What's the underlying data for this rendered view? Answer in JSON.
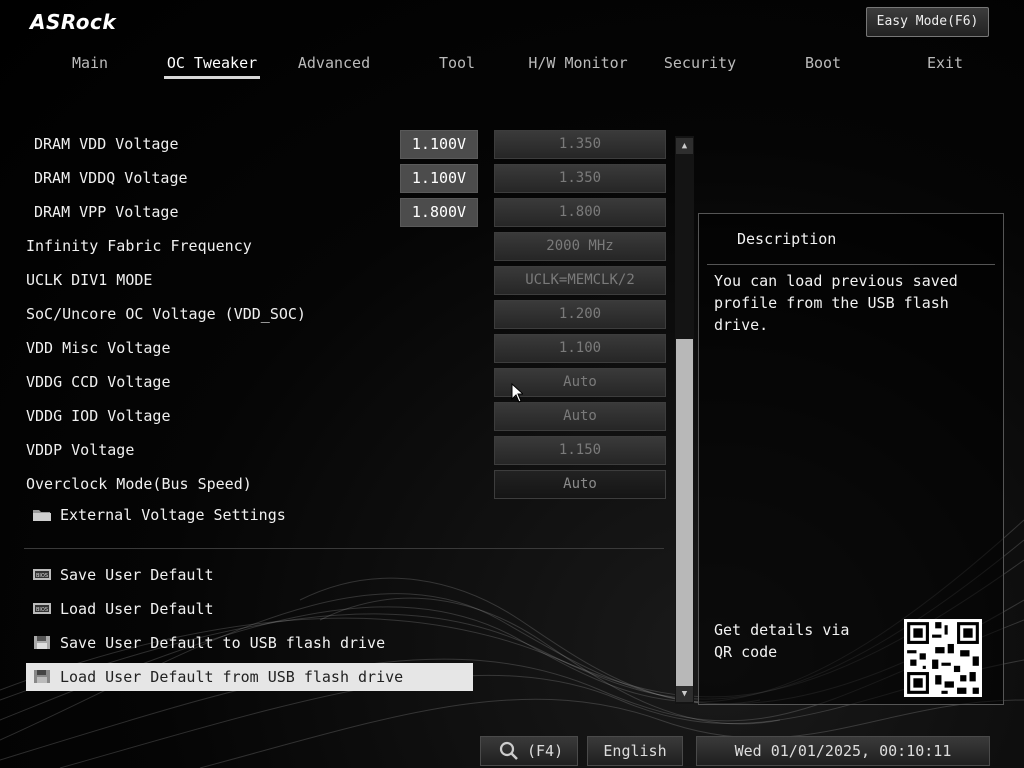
{
  "header": {
    "logo": "ASRock",
    "easy_mode_label": "Easy Mode(F6)"
  },
  "tabs": [
    {
      "label": "Main",
      "active": false
    },
    {
      "label": "OC Tweaker",
      "active": true
    },
    {
      "label": "Advanced",
      "active": false
    },
    {
      "label": "Tool",
      "active": false
    },
    {
      "label": "H/W Monitor",
      "active": false
    },
    {
      "label": "Security",
      "active": false
    },
    {
      "label": "Boot",
      "active": false
    },
    {
      "label": "Exit",
      "active": false
    }
  ],
  "settings": [
    {
      "label": "DRAM VDD Voltage",
      "current": "1.100V",
      "value": "1.350"
    },
    {
      "label": "DRAM VDDQ Voltage",
      "current": "1.100V",
      "value": "1.350"
    },
    {
      "label": "DRAM VPP Voltage",
      "current": "1.800V",
      "value": "1.800"
    },
    {
      "label": "Infinity Fabric Frequency",
      "current": "",
      "value": "2000 MHz"
    },
    {
      "label": "UCLK DIV1 MODE",
      "current": "",
      "value": "UCLK=MEMCLK/2"
    },
    {
      "label": "SoC/Uncore OC Voltage (VDD_SOC)",
      "current": "",
      "value": "1.200"
    },
    {
      "label": "VDD Misc Voltage",
      "current": "",
      "value": "1.100"
    },
    {
      "label": "VDDG CCD Voltage",
      "current": "",
      "value": "Auto"
    },
    {
      "label": "VDDG IOD Voltage",
      "current": "",
      "value": "Auto"
    },
    {
      "label": "VDDP Voltage",
      "current": "",
      "value": "1.150"
    },
    {
      "label": "Overclock Mode(Bus Speed)",
      "current": "",
      "value": "Auto"
    }
  ],
  "submenu": {
    "label": "External Voltage Settings",
    "icon": "folder-icon"
  },
  "actions": [
    {
      "label": "Save User Default",
      "icon": "bios-chip-icon",
      "selected": false
    },
    {
      "label": "Load User Default",
      "icon": "bios-chip-icon",
      "selected": false
    },
    {
      "label": "Save User Default to USB flash drive",
      "icon": "floppy-disk-icon",
      "selected": false
    },
    {
      "label": "Load User Default from USB flash drive",
      "icon": "floppy-disk-icon",
      "selected": true
    }
  ],
  "description": {
    "title": "Description",
    "text": "You can load previous saved profile from the USB flash drive.",
    "qr_text": "Get details via QR code"
  },
  "footer": {
    "search_label": "(F4)",
    "language": "English",
    "datetime": "Wed 01/01/2025, 00:10:11"
  },
  "scrollbar": {
    "position_fraction": 0.45,
    "visible_fraction": 0.62
  }
}
